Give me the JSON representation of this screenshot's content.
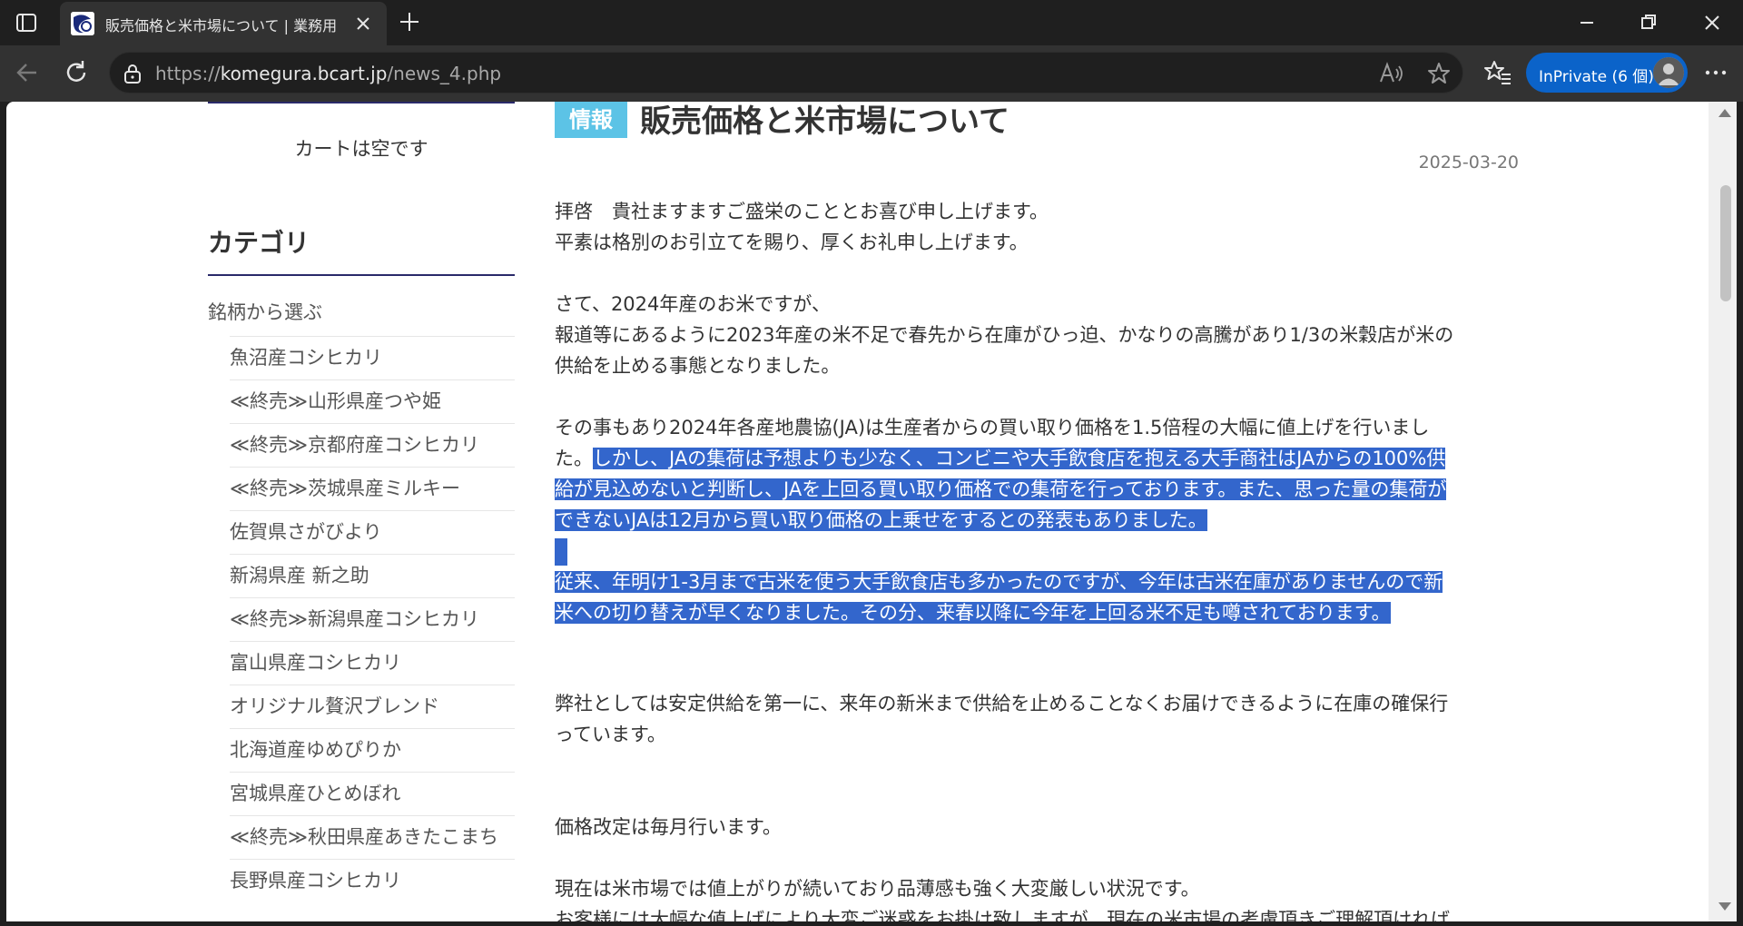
{
  "browser": {
    "tab_title": "販売価格と米市場について | 業務用",
    "url_scheme": "https://",
    "url_host": "komegura.bcart.jp",
    "url_path": "/news_4.php",
    "inprivate_label": "InPrivate (6 個)",
    "accent_color": "#0b63c9"
  },
  "sidebar": {
    "cart_text": "カートは空です",
    "category_title": "カテゴリ",
    "group_label": "銘柄から選ぶ",
    "items": [
      "魚沼産コシヒカリ",
      "≪終売≫山形県産つや姫",
      "≪終売≫京都府産コシヒカリ",
      "≪終売≫茨城県産ミルキー",
      "佐賀県さがびより",
      "新潟県産 新之助",
      "≪終売≫新潟県産コシヒカリ",
      "富山県産コシヒカリ",
      "オリジナル贅沢ブレンド",
      "北海道産ゆめぴりか",
      "宮城県産ひとめぼれ",
      "≪終売≫秋田県産あきたこまち",
      "長野県産コシヒカリ"
    ]
  },
  "article": {
    "badge": "情報",
    "headline": "販売価格と米市場について",
    "date": "2025-03-20",
    "p1_l1": "拝啓　貴社ますますご盛栄のこととお喜び申し上げます。",
    "p1_l2": "平素は格別のお引立てを賜り、厚くお礼申し上げます。",
    "p2_l1": "さて、2024年産のお米ですが、",
    "p2_l2": "報道等にあるように2023年産の米不足で春先から在庫がひっ迫、かなりの高騰があり1/3の米穀店が米の",
    "p2_l3": "供給を止める事態となりました。",
    "p3_l1": "その事もあり2024年各産地農協(JA)は生産者からの買い取り価格を1.5倍程の大幅に値上げを行いまし",
    "p3_l2a": "た。",
    "p3_l2b": "しかし、JAの集荷は予想よりも少なく、コンビニや大手飲食店を抱える大手商社はJAからの100%供",
    "p3_l3": "給が見込めないと判断し、JAを上回る買い取り価格での集荷を行っております。また、思った量の集荷が",
    "p3_l4": "できないJAは12月から買い取り価格の上乗せをするとの発表もありました。",
    "p4_l1": "従来、年明け1-3月まで古米を使う大手飲食店も多かったのですが、今年は古米在庫がありませんので新",
    "p4_l2": "米への切り替えが早くなりました。その分、来春以降に今年を上回る米不足も噂されております。",
    "p5_l1": "弊社としては安定供給を第一に、来年の新米まで供給を止めることなくお届けできるように在庫の確保行",
    "p5_l2": "っています。",
    "p6_l1": "価格改定は毎月行います。",
    "p7_l1": "現在は米市場では値上がりが続いており品薄感も強く大変厳しい状況です。",
    "p7_l2": "お客様には大幅な値上げにより大変ご迷惑をお掛け致しますが、現在の米市場の考慮頂きご理解頂ければ"
  }
}
